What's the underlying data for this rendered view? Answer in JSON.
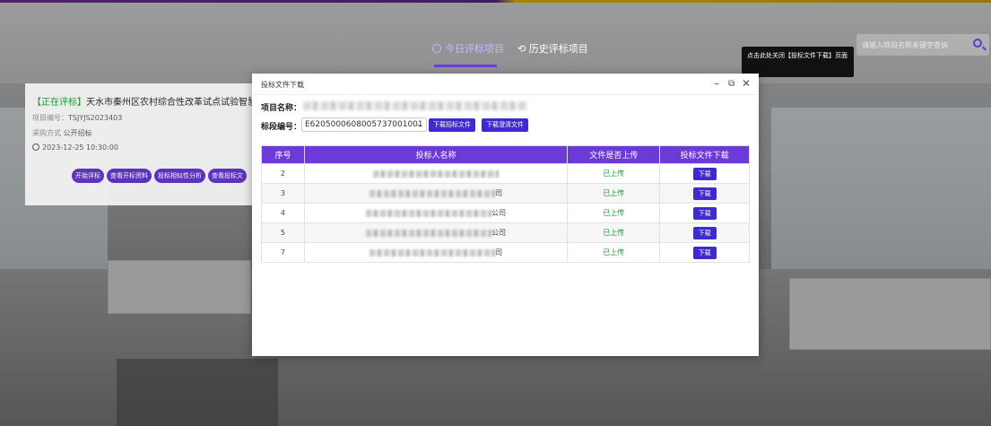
{
  "nav": {
    "tab_today": "今日评标项目",
    "tab_history": "历史评标项目",
    "search_placeholder": "请输入项目名称关键字查询"
  },
  "tooltip": "点击此处关闭【投标文件下载】页面",
  "project_card": {
    "status_tag": "【正在评标】",
    "title": "天水市秦州区农村综合性改革试点试验智慧农业实",
    "project_no_label": "项目编号：",
    "project_no": "TSJYJS2023403",
    "method_label": "采购方式",
    "method": "公开招标",
    "datetime": "2023-12-25 10:30:00",
    "buttons": [
      "开始评标",
      "查看开标资料",
      "投标相似性分析",
      "查看投标文"
    ]
  },
  "modal": {
    "title": "投标文件下载",
    "project_name_label": "项目名称：",
    "lot_label": "标段编号：",
    "lot_value": "E6205000608005737001001",
    "btn_download_bid": "下载招标文件",
    "btn_download_clarify": "下载澄清文件",
    "columns": [
      "序号",
      "投标人名称",
      "文件是否上传",
      "投标文件下载"
    ],
    "rows": [
      {
        "no": "2",
        "tail": "",
        "uploaded": "已上传",
        "download": "下载"
      },
      {
        "no": "3",
        "tail": "司",
        "uploaded": "已上传",
        "download": "下载"
      },
      {
        "no": "4",
        "tail": "公司",
        "uploaded": "已上传",
        "download": "下载"
      },
      {
        "no": "5",
        "tail": "公司",
        "uploaded": "已上传",
        "download": "下载"
      },
      {
        "no": "7",
        "tail": "司",
        "uploaded": "已上传",
        "download": "下载"
      }
    ]
  },
  "colors": {
    "accent_purple": "#6c3ad6",
    "button_blue": "#3d2bd0",
    "success_green": "#1a9a2e"
  }
}
